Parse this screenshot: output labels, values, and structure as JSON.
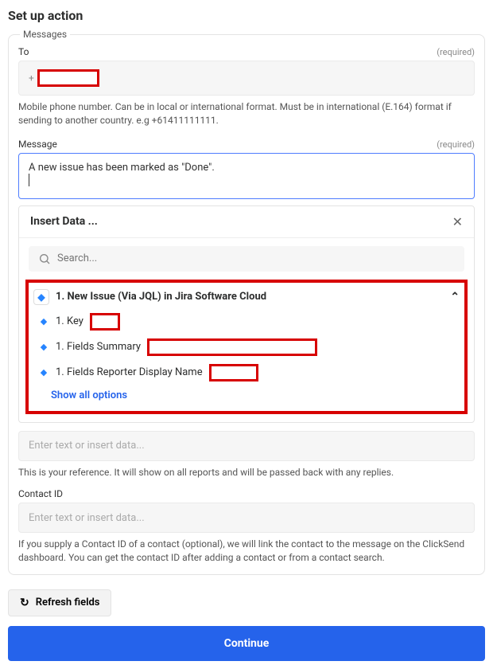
{
  "title": "Set up action",
  "section_legend": "Messages",
  "fields": {
    "to": {
      "label": "To",
      "required": "(required)",
      "help": "Mobile phone number. Can be in local or international format. Must be in international (E.164) format if sending to another country. e.g +61411111111."
    },
    "message": {
      "label": "Message",
      "required": "(required)",
      "value": "A new issue has been marked as \"Done\"."
    },
    "reference": {
      "placeholder": "Enter text or insert data...",
      "help": "This is your reference. It will show on all reports and will be passed back with any replies."
    },
    "contact_id": {
      "label": "Contact ID",
      "placeholder": "Enter text or insert data...",
      "help": "If you supply a Contact ID of a contact (optional), we will link the contact to the message on the ClickSend dashboard. You can get the contact ID after adding a contact or from a contact search."
    }
  },
  "insert": {
    "title": "Insert Data ...",
    "search_placeholder": "Search...",
    "source_title": "1. New Issue (Via JQL) in Jira Software Cloud",
    "items": [
      {
        "label": "1. Key",
        "redact_width": 38
      },
      {
        "label": "1. Fields Summary",
        "redact_width": 214
      },
      {
        "label": "1. Fields Reporter Display Name",
        "redact_width": 62
      }
    ],
    "show_all": "Show all options"
  },
  "refresh_label": "Refresh fields",
  "continue_label": "Continue"
}
